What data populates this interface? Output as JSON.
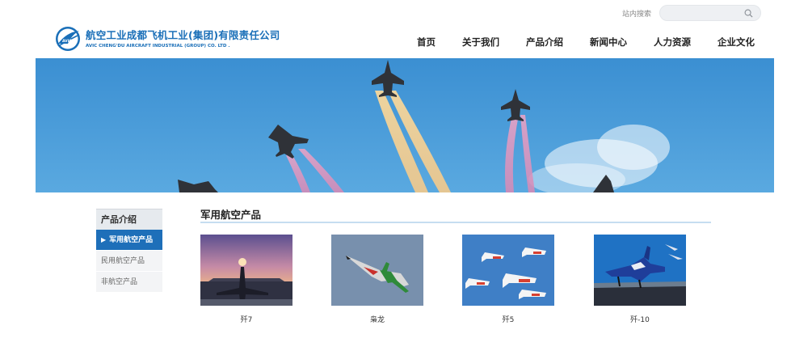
{
  "header": {
    "search_label": "站内搜索",
    "search_value": "",
    "logo_cn": "航空工业成都飞机工业(集团)有限责任公司",
    "logo_en": "AVIC CHENG'DU AIRCRAFT INDUSTRIAL (GROUP) CO. LTD .",
    "logo_badge": "AVIC"
  },
  "nav": {
    "items": [
      {
        "label": "首页"
      },
      {
        "label": "关于我们"
      },
      {
        "label": "产品介绍"
      },
      {
        "label": "新闻中心"
      },
      {
        "label": "人力资源"
      },
      {
        "label": "企业文化"
      }
    ]
  },
  "sidebar": {
    "title": "产品介绍",
    "items": [
      {
        "label": "军用航空产品",
        "active": true
      },
      {
        "label": "民用航空产品",
        "active": false
      },
      {
        "label": "非航空产品",
        "active": false
      }
    ]
  },
  "main": {
    "section_title": "军用航空产品",
    "products": [
      {
        "caption": "歼7"
      },
      {
        "caption": "枭龙"
      },
      {
        "caption": "歼5"
      },
      {
        "caption": "歼-10"
      }
    ]
  },
  "colors": {
    "brand_blue": "#1a6fb8",
    "active_blue": "#1e6fb9",
    "sky": "#3a94d6"
  },
  "icons": {
    "search": "search-icon",
    "logo": "avic-logo-icon",
    "active_arrow": "triangle-right-icon"
  }
}
